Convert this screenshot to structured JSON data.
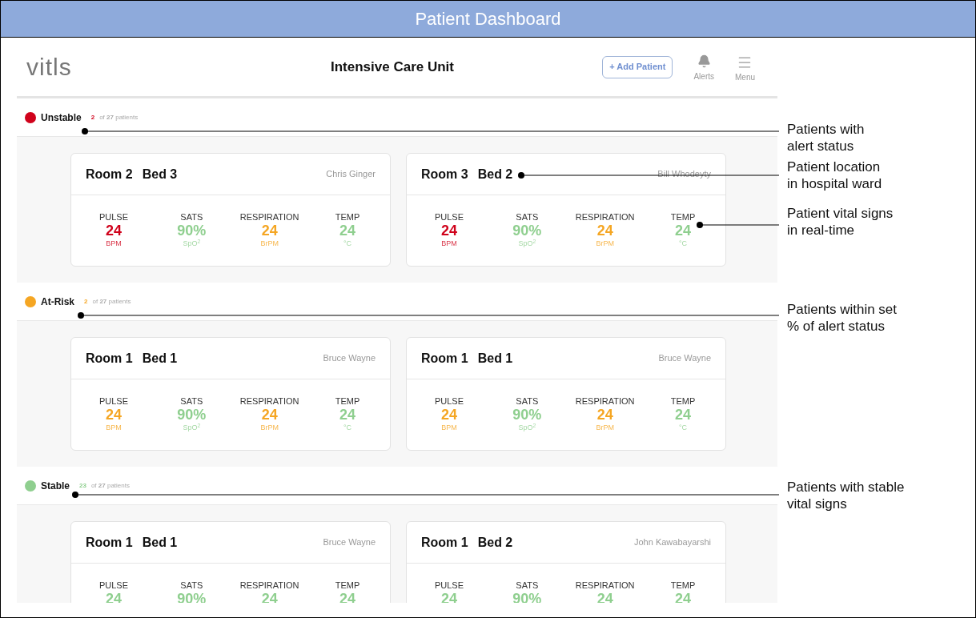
{
  "window": {
    "title": "Patient Dashboard"
  },
  "header": {
    "logo": "vitls",
    "title": "Intensive Care Unit",
    "add_button": "+ Add Patient",
    "alerts": "Alerts",
    "menu": "Menu"
  },
  "sections": [
    {
      "name": "Unstable",
      "color": "#d0021b",
      "count": "2",
      "rest": "of **27** patients",
      "patients": [
        {
          "room": "Room 2",
          "bed": "Bed 3",
          "name": "Chris Ginger",
          "vitals": [
            {
              "label": "PULSE",
              "value": "24",
              "unit": "BPM",
              "color": "#d0021b"
            },
            {
              "label": "SATS",
              "value": "90%",
              "unit": "SpO$^{2}$",
              "color": "#8fcf8f"
            },
            {
              "label": "RESPIRATION",
              "value": "24",
              "unit": "BrPM",
              "color": "#f5a623"
            },
            {
              "label": "TEMP",
              "value": "24",
              "unit": "°C",
              "color": "#8fcf8f"
            }
          ]
        },
        {
          "room": "Room 3",
          "bed": "Bed 2",
          "name": "Bill Whodeyty",
          "vitals": [
            {
              "label": "PULSE",
              "value": "24",
              "unit": "BPM",
              "color": "#d0021b"
            },
            {
              "label": "SATS",
              "value": "90%",
              "unit": "SpO$^{2}$",
              "color": "#8fcf8f"
            },
            {
              "label": "RESPIRATION",
              "value": "24",
              "unit": "BrPM",
              "color": "#f5a623"
            },
            {
              "label": "TEMP",
              "value": "24",
              "unit": "°C",
              "color": "#8fcf8f"
            }
          ]
        }
      ]
    },
    {
      "name": "At-Risk",
      "color": "#f5a623",
      "count": "2",
      "rest": "of **27** patients",
      "patients": [
        {
          "room": "Room 1",
          "bed": "Bed 1",
          "name": "Bruce Wayne",
          "vitals": [
            {
              "label": "PULSE",
              "value": "24",
              "unit": "BPM",
              "color": "#f5a623"
            },
            {
              "label": "SATS",
              "value": "90%",
              "unit": "SpO$^{2}$",
              "color": "#8fcf8f"
            },
            {
              "label": "RESPIRATION",
              "value": "24",
              "unit": "BrPM",
              "color": "#f5a623"
            },
            {
              "label": "TEMP",
              "value": "24",
              "unit": "°C",
              "color": "#8fcf8f"
            }
          ]
        },
        {
          "room": "Room 1",
          "bed": "Bed 1",
          "name": "Bruce Wayne",
          "vitals": [
            {
              "label": "PULSE",
              "value": "24",
              "unit": "BPM",
              "color": "#f5a623"
            },
            {
              "label": "SATS",
              "value": "90%",
              "unit": "SpO$^{2}$",
              "color": "#8fcf8f"
            },
            {
              "label": "RESPIRATION",
              "value": "24",
              "unit": "BrPM",
              "color": "#f5a623"
            },
            {
              "label": "TEMP",
              "value": "24",
              "unit": "°C",
              "color": "#8fcf8f"
            }
          ]
        }
      ]
    },
    {
      "name": "Stable",
      "color": "#8fcf8f",
      "count": "23",
      "rest": "of **27** patients",
      "patients": [
        {
          "room": "Room 1",
          "bed": "Bed 1",
          "name": "Bruce Wayne",
          "vitals": [
            {
              "label": "PULSE",
              "value": "24",
              "color": "#8fcf8f"
            },
            {
              "label": "SATS",
              "value": "90%",
              "color": "#8fcf8f"
            },
            {
              "label": "RESPIRATION",
              "value": "24",
              "color": "#8fcf8f"
            },
            {
              "label": "TEMP",
              "value": "24",
              "color": "#8fcf8f"
            }
          ]
        },
        {
          "room": "Room 1",
          "bed": "Bed 2",
          "name": "John Kawabayarshi",
          "vitals": [
            {
              "label": "PULSE",
              "value": "24",
              "color": "#8fcf8f"
            },
            {
              "label": "SATS",
              "value": "90%",
              "color": "#8fcf8f"
            },
            {
              "label": "RESPIRATION",
              "value": "24",
              "color": "#8fcf8f"
            },
            {
              "label": "TEMP",
              "value": "24",
              "color": "#8fcf8f"
            }
          ]
        }
      ]
    }
  ],
  "annotations": [
    {
      "lines": [
        "Patients with",
        "alert status"
      ]
    },
    {
      "lines": [
        "Patient location",
        "in hospital ward"
      ]
    },
    {
      "lines": [
        "Patient vital signs",
        "in real-time"
      ]
    },
    {
      "lines": [
        "Patients within set",
        "% of alert status"
      ]
    },
    {
      "lines": [
        "Patients with stable",
        "vital signs"
      ]
    }
  ]
}
